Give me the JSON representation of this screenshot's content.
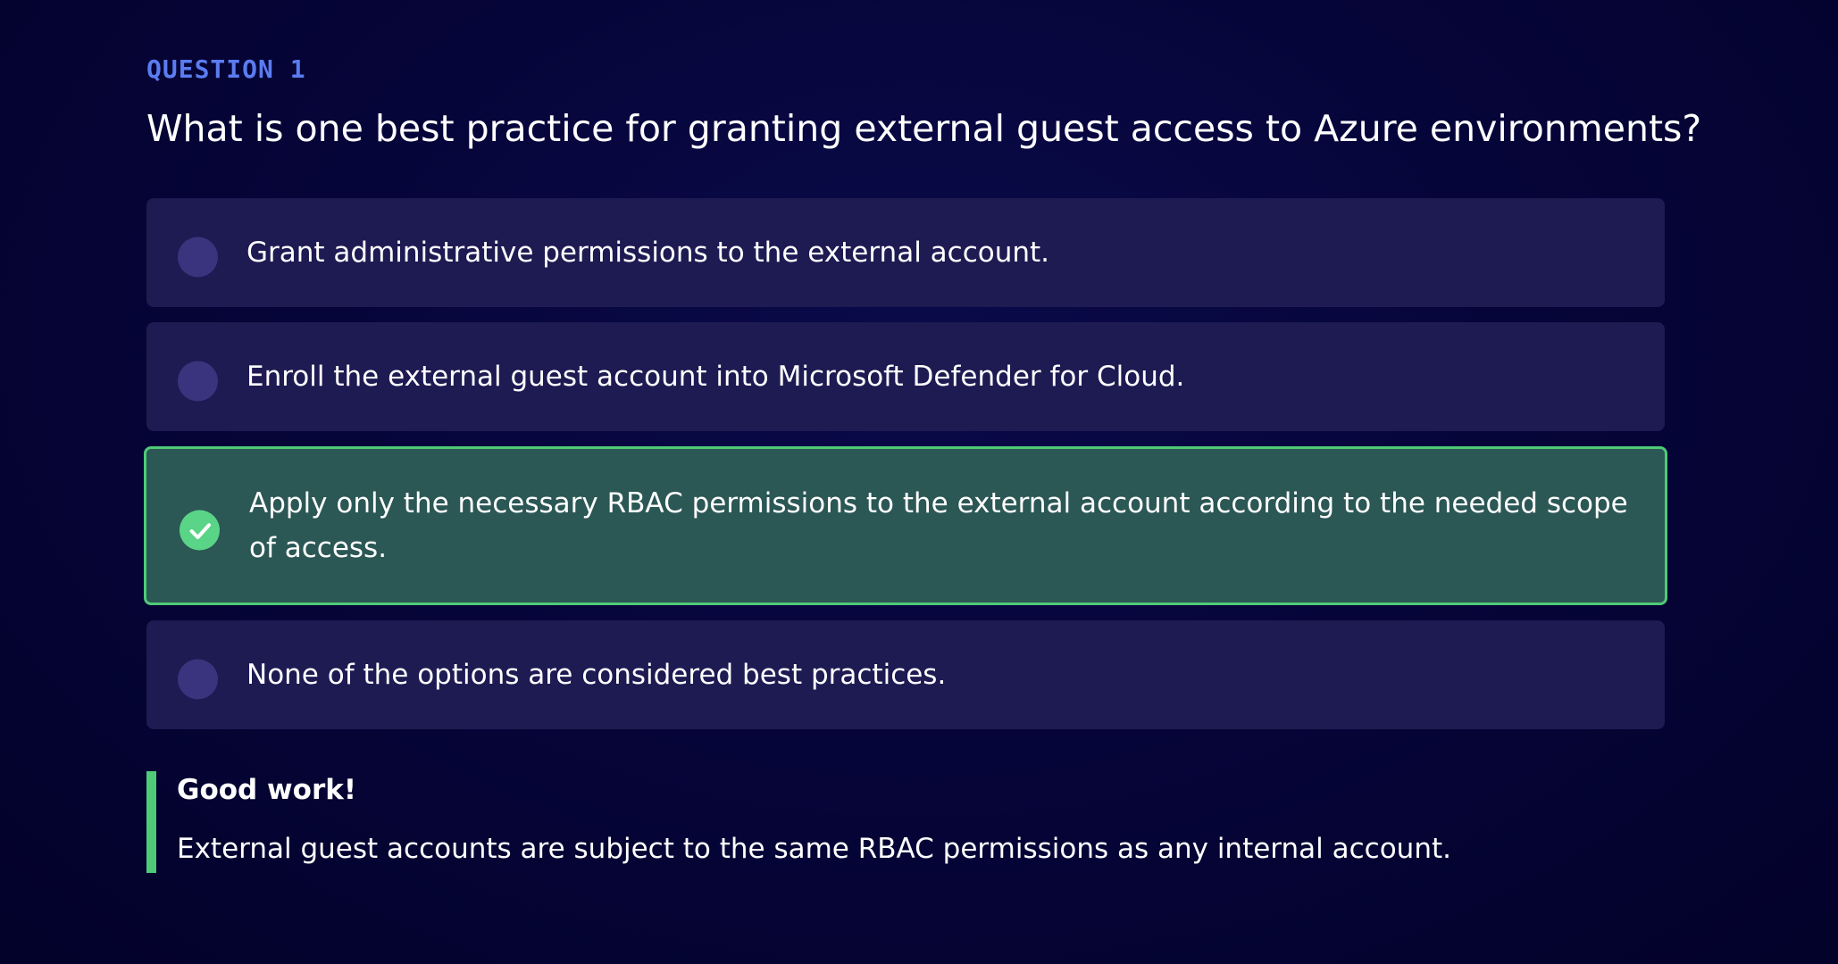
{
  "question": {
    "label": "QUESTION 1",
    "text": "What is one best practice for granting external guest access to Azure environments?"
  },
  "options": [
    {
      "text": "Grant administrative permissions to the external account.",
      "selected": false,
      "correct": false
    },
    {
      "text": "Enroll the external guest account into Microsoft Defender for Cloud.",
      "selected": false,
      "correct": false
    },
    {
      "text": "Apply only the necessary RBAC permissions to the external account according to the needed scope of access.",
      "selected": true,
      "correct": true,
      "icon": "checkmark-icon"
    },
    {
      "text": "None of the options are considered best practices.",
      "selected": false,
      "correct": false
    }
  ],
  "feedback": {
    "title": "Good work!",
    "text": "External guest accounts are subject to the same RBAC permissions as any internal account."
  },
  "colors": {
    "accent_label": "#5b7cf0",
    "option_bg": "#1e1a52",
    "correct_bg": "#2b5755",
    "correct_border": "#4fca77",
    "radio_idle": "#3a347f"
  }
}
